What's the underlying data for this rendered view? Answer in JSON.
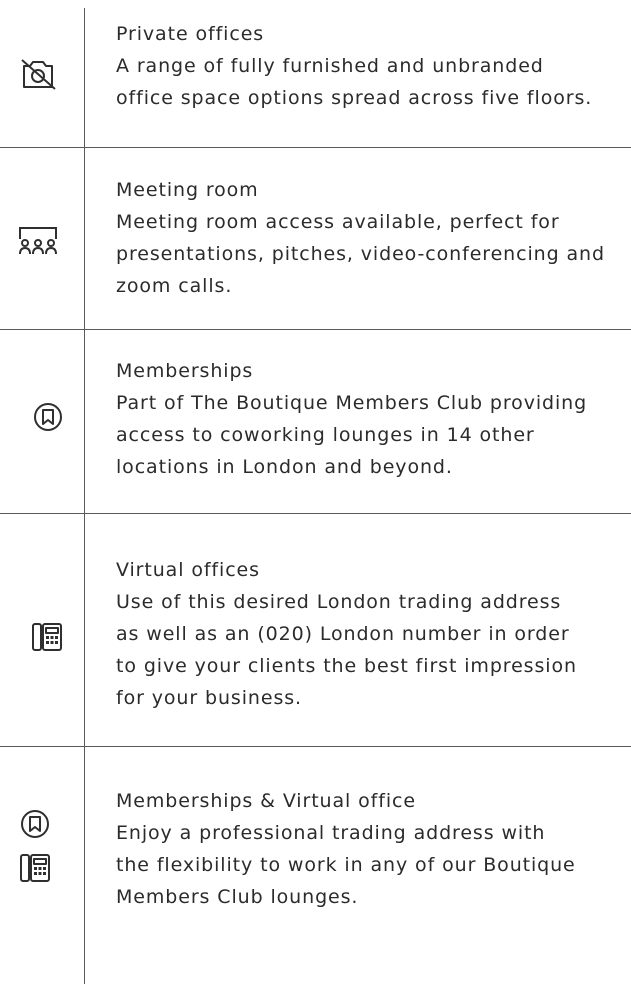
{
  "features": [
    {
      "title": "Private offices",
      "lines": [
        "A range of fully furnished and unbranded",
        "office space options spread across five floors."
      ],
      "icons": [
        "camera-off-icon"
      ]
    },
    {
      "title": "Meeting room",
      "lines": [
        "Meeting room access available, perfect for",
        "presentations, pitches, video-conferencing and",
        "zoom calls."
      ],
      "icons": [
        "meeting-table-icon"
      ]
    },
    {
      "title": "Memberships",
      "lines": [
        "Part of The Boutique Members Club providing",
        "access to coworking lounges in 14 other",
        "locations in London and beyond."
      ],
      "icons": [
        "bookmark-circle-icon"
      ]
    },
    {
      "title": "Virtual offices",
      "lines": [
        "Use of this desired London trading address",
        "as well as an (020) London number in order",
        "to give your clients the best first impression",
        "for your business."
      ],
      "icons": [
        "office-phone-icon"
      ]
    },
    {
      "title": "Memberships & Virtual office",
      "lines": [
        "Enjoy a professional trading address with",
        "the flexibility to work in any of our Boutique",
        "Members Club lounges."
      ],
      "icons": [
        "bookmark-circle-icon",
        "office-phone-icon"
      ]
    }
  ]
}
